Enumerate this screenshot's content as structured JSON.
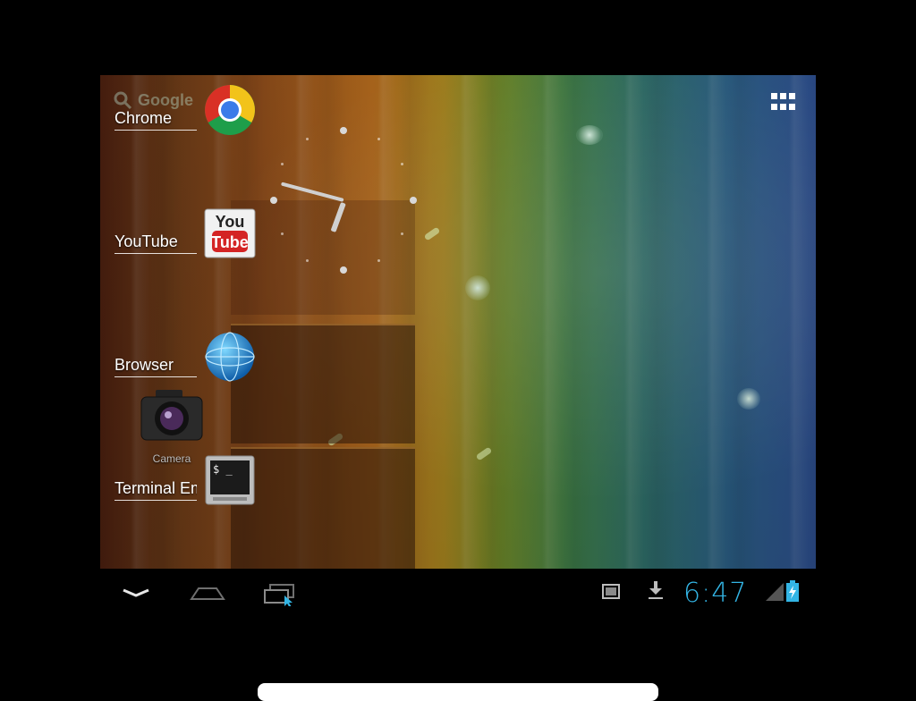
{
  "colors": {
    "status_clock": "#33b5e5",
    "nav_icon": "#cfcfcf",
    "label_text": "#ffffff"
  },
  "search": {
    "label": "Google",
    "icon": "search-icon"
  },
  "apps_button": {
    "icon": "all-apps-grid-icon"
  },
  "launcher": {
    "items": [
      {
        "label": "Chrome",
        "icon": "chrome-icon"
      },
      {
        "label": "YouTube",
        "icon": "youtube-icon"
      },
      {
        "label": "Browser",
        "icon": "browser-globe-icon"
      },
      {
        "label": "Terminal Emulator",
        "icon": "terminal-icon"
      }
    ],
    "camera": {
      "label": "Camera",
      "icon": "camera-icon"
    }
  },
  "clock_widget": {
    "icon": "analog-clock-widget"
  },
  "system_bar": {
    "nav": [
      {
        "icon": "back-icon"
      },
      {
        "icon": "home-icon"
      },
      {
        "icon": "recent-apps-icon"
      }
    ],
    "notifications": [
      {
        "icon": "screenshot-notification-icon"
      },
      {
        "icon": "download-icon"
      }
    ],
    "time": "6:47",
    "status_icons": [
      "signal-icon",
      "battery-charging-icon"
    ]
  }
}
